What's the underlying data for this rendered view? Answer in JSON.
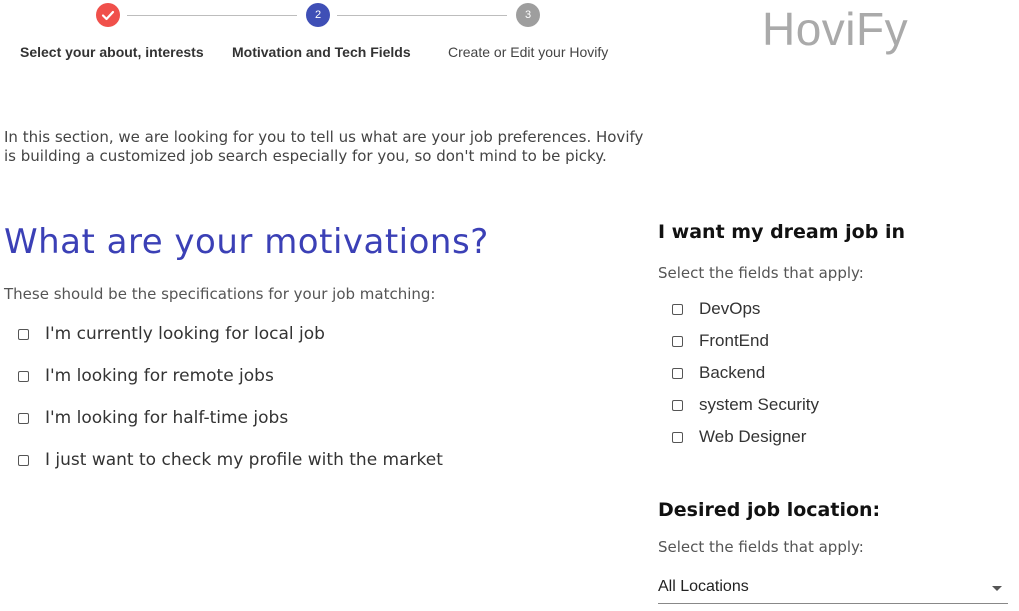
{
  "stepper": {
    "steps": [
      {
        "number": "1",
        "label": "Select your about, interests",
        "state": "completed",
        "color": "#f0504b",
        "icon": "check-icon"
      },
      {
        "number": "2",
        "label": "Motivation and Tech Fields",
        "state": "active",
        "color": "#3f4fb6"
      },
      {
        "number": "3",
        "label": "Create or Edit your Hovify",
        "state": "pending",
        "color": "#9e9e9e"
      }
    ]
  },
  "brand": "HoviFy",
  "intro": "In this section, we are looking for you to tell us what are your job preferences. Hovify is building a customized job search especially for you, so don't mind to be picky.",
  "motivations": {
    "title": "What are your motivations?",
    "subtitle": "These should be the specifications for your job matching:",
    "options": [
      {
        "label": "I'm currently looking for local job",
        "checked": false
      },
      {
        "label": "I'm looking for remote jobs",
        "checked": false
      },
      {
        "label": "I'm looking for half-time jobs",
        "checked": false
      },
      {
        "label": "I just want to check my profile with the market",
        "checked": false
      }
    ]
  },
  "fields": {
    "title": "I want my dream job in",
    "subtitle": "Select the fields that apply:",
    "options": [
      {
        "label": "DevOps",
        "checked": false
      },
      {
        "label": "FrontEnd",
        "checked": false
      },
      {
        "label": "Backend",
        "checked": false
      },
      {
        "label": "system Security",
        "checked": false
      },
      {
        "label": "Web Designer",
        "checked": false
      }
    ]
  },
  "location": {
    "title": "Desired job location:",
    "subtitle": "Select the fields that apply:",
    "selected": "All Locations"
  },
  "colors": {
    "accent": "#3b40b6",
    "brand_text": "#aaaaaa"
  }
}
